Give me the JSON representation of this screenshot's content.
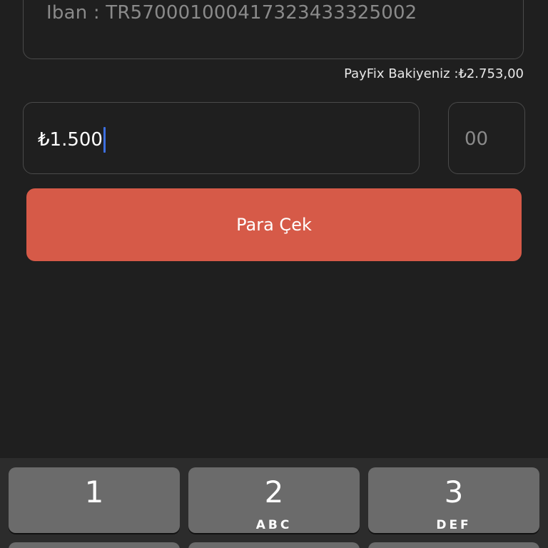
{
  "form": {
    "iban_text": "Iban : TR570001000417323433325002",
    "balance_text": "PayFix Bakiyeniz :₺2.753,00",
    "amount_value": "₺1.500",
    "cents_placeholder": "00",
    "submit_label": "Para Çek"
  },
  "keyboard": {
    "keys": [
      {
        "num": "1",
        "letters": ""
      },
      {
        "num": "2",
        "letters": "ABC"
      },
      {
        "num": "3",
        "letters": "DEF"
      }
    ]
  },
  "colors": {
    "background": "#1f1f1f",
    "accent": "#d65a48",
    "caret": "#3d6fe0"
  }
}
